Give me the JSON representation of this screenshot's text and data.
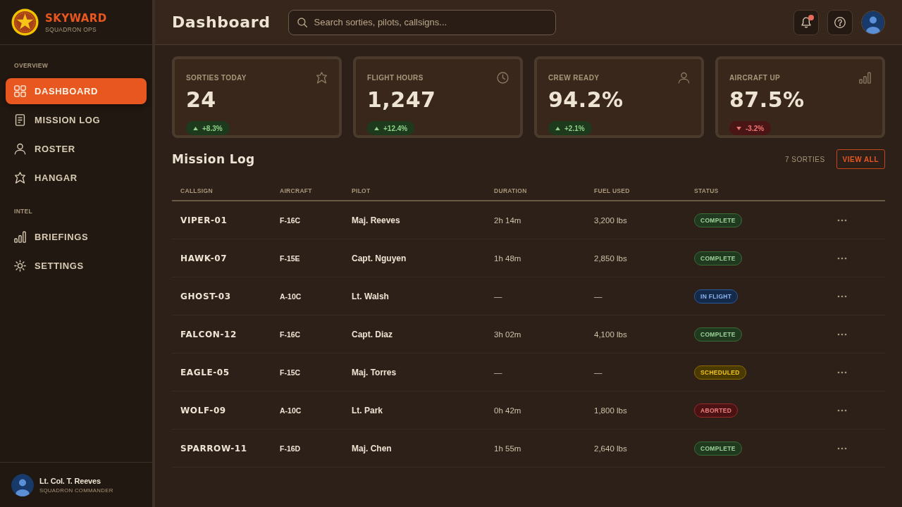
{
  "sidebar": {
    "brand": {
      "name": "SKYWARD",
      "tagline": "SQUADRON OPS"
    },
    "sections": [
      {
        "label": "OVERVIEW",
        "items": [
          {
            "label": "DASHBOARD",
            "selected": true
          },
          {
            "label": "MISSION LOG",
            "selected": false
          },
          {
            "label": "ROSTER",
            "selected": false
          },
          {
            "label": "HANGAR",
            "selected": false
          }
        ]
      },
      {
        "label": "INTEL",
        "items": [
          {
            "label": "BRIEFINGS",
            "selected": false
          },
          {
            "label": "SETTINGS",
            "selected": false
          }
        ]
      }
    ],
    "user": {
      "name": "Lt. Col. T. Reeves",
      "role": "SQUADRON COMMANDER"
    }
  },
  "header": {
    "title": "Dashboard",
    "search": {
      "placeholder": "Search sorties, pilots, callsigns..."
    },
    "notifications": {
      "unread": true
    }
  },
  "stats": [
    {
      "label": "SORTIES TODAY",
      "value": "24",
      "delta": {
        "label": "+8.3%",
        "kind": "up"
      }
    },
    {
      "label": "FLIGHT HOURS",
      "value": "1,247",
      "delta": {
        "label": "+12.4%",
        "kind": "up"
      }
    },
    {
      "label": "CREW READY",
      "value": "94.2%",
      "delta": {
        "label": "+2.1%",
        "kind": "up"
      }
    },
    {
      "label": "AIRCRAFT UP",
      "value": "87.5%",
      "delta": {
        "label": "-3.2%",
        "kind": "down"
      }
    }
  ],
  "mission_log": {
    "title": "Mission Log",
    "count": "7 SORTIES",
    "action": "VIEW ALL",
    "columns": [
      "CALLSIGN",
      "AIRCRAFT",
      "PILOT",
      "DURATION",
      "FUEL USED",
      "STATUS"
    ],
    "rows": [
      {
        "callsign": "VIPER-01",
        "aircraft": "F-16C",
        "pilot": "Maj. Reeves",
        "duration": "2h 14m",
        "fuel": "3,200 lbs",
        "status": {
          "label": "COMPLETE",
          "kind": "complete"
        }
      },
      {
        "callsign": "HAWK-07",
        "aircraft": "F-15E",
        "pilot": "Capt. Nguyen",
        "duration": "1h 48m",
        "fuel": "2,850 lbs",
        "status": {
          "label": "COMPLETE",
          "kind": "complete"
        }
      },
      {
        "callsign": "GHOST-03",
        "aircraft": "A-10C",
        "pilot": "Lt. Walsh",
        "duration": "—",
        "fuel": "—",
        "status": {
          "label": "IN FLIGHT",
          "kind": "in_flight"
        }
      },
      {
        "callsign": "FALCON-12",
        "aircraft": "F-16C",
        "pilot": "Capt. Diaz",
        "duration": "3h 02m",
        "fuel": "4,100 lbs",
        "status": {
          "label": "COMPLETE",
          "kind": "complete"
        }
      },
      {
        "callsign": "EAGLE-05",
        "aircraft": "F-15C",
        "pilot": "Maj. Torres",
        "duration": "—",
        "fuel": "—",
        "status": {
          "label": "SCHEDULED",
          "kind": "scheduled"
        }
      },
      {
        "callsign": "WOLF-09",
        "aircraft": "A-10C",
        "pilot": "Lt. Park",
        "duration": "0h 42m",
        "fuel": "1,800 lbs",
        "status": {
          "label": "ABORTED",
          "kind": "aborted"
        }
      },
      {
        "callsign": "SPARROW-11",
        "aircraft": "F-16D",
        "pilot": "Maj. Chen",
        "duration": "1h 55m",
        "fuel": "2,640 lbs",
        "status": {
          "label": "COMPLETE",
          "kind": "complete"
        }
      }
    ]
  }
}
